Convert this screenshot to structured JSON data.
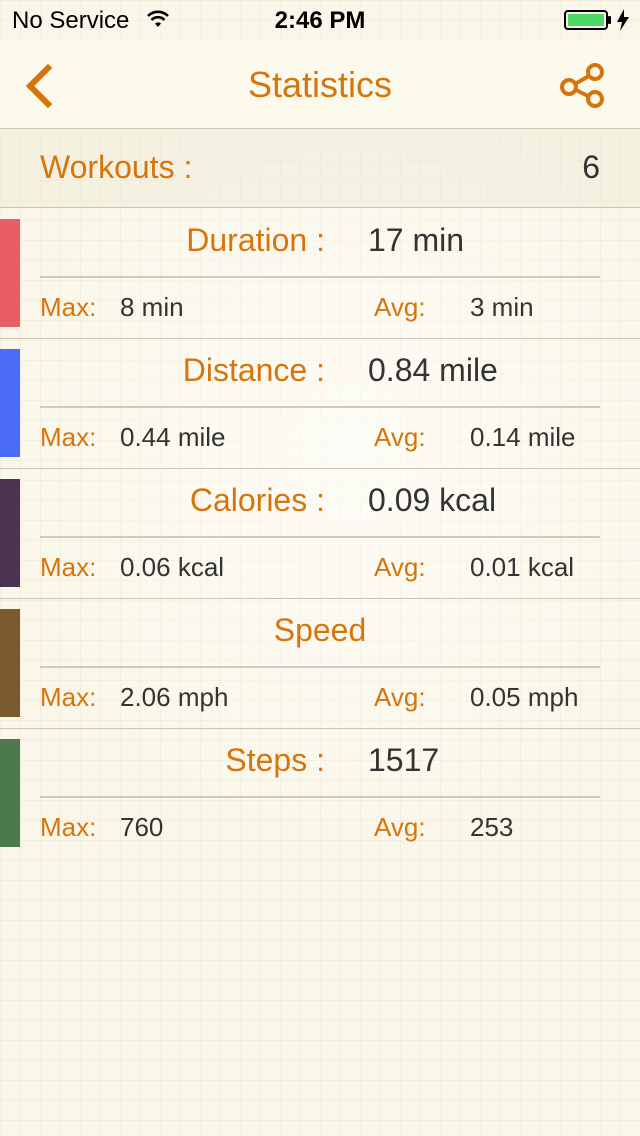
{
  "status_bar": {
    "carrier": "No Service",
    "time": "2:46 PM",
    "wifi_icon": "wifi-icon",
    "battery_icon": "battery-charging-icon",
    "battery_color": "#4cd964"
  },
  "nav": {
    "title": "Statistics",
    "back_icon": "chevron-left-icon",
    "share_icon": "share-icon",
    "accent_color": "#d7740c"
  },
  "workouts": {
    "label": "Workouts :",
    "value": "6"
  },
  "stats": {
    "duration": {
      "label": "Duration :",
      "value": "17 min",
      "max_label": "Max:",
      "max_value": "8 min",
      "avg_label": "Avg:",
      "avg_value": "3 min",
      "color": "#e85d66"
    },
    "distance": {
      "label": "Distance :",
      "value": "0.84 mile",
      "max_label": "Max:",
      "max_value": "0.44 mile",
      "avg_label": "Avg:",
      "avg_value": "0.14 mile",
      "color": "#4a6cf7"
    },
    "calories": {
      "label": "Calories :",
      "value": "0.09 kcal",
      "max_label": "Max:",
      "max_value": "0.06 kcal",
      "avg_label": "Avg:",
      "avg_value": "0.01 kcal",
      "color": "#4b3352"
    },
    "speed": {
      "label": "Speed",
      "max_label": "Max:",
      "max_value": "2.06 mph",
      "avg_label": "Avg:",
      "avg_value": "0.05 mph",
      "color": "#7a5a2e"
    },
    "steps": {
      "label": "Steps :",
      "value": "1517",
      "max_label": "Max:",
      "max_value": "760",
      "avg_label": "Avg:",
      "avg_value": "253",
      "color": "#4c7a4e"
    }
  }
}
